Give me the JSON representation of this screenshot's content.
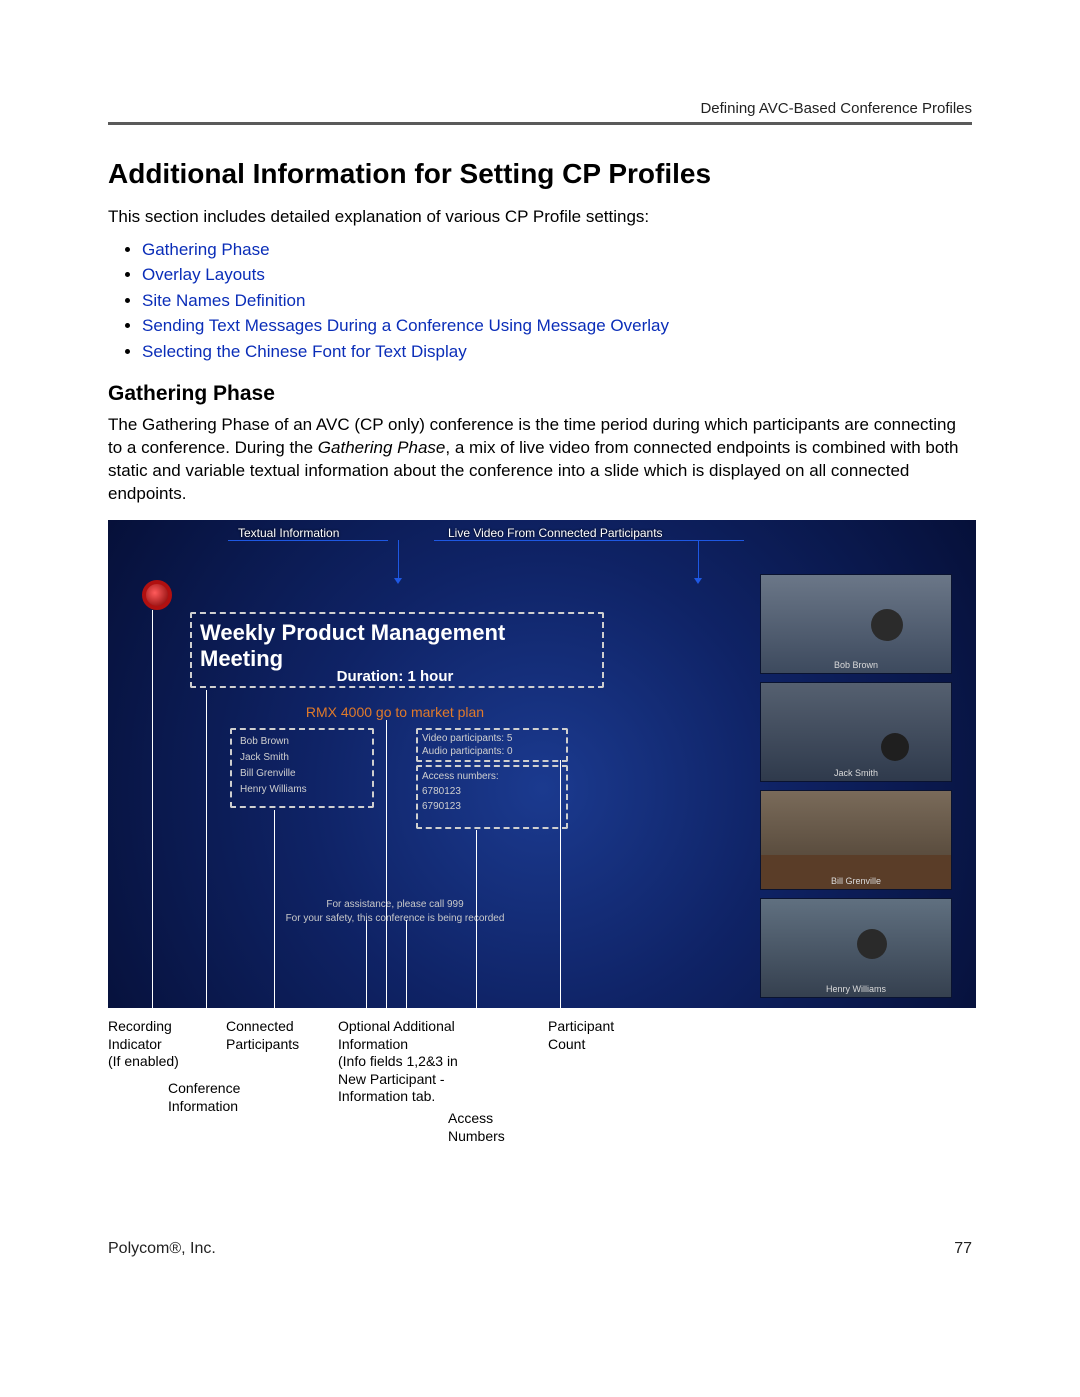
{
  "header": {
    "section": "Defining AVC-Based Conference Profiles"
  },
  "main": {
    "h1": "Additional Information for Setting CP Profiles",
    "intro": "This section includes detailed explanation of various CP Profile settings:",
    "links": [
      "Gathering Phase",
      "Overlay Layouts",
      "Site Names Definition",
      "Sending Text Messages During a Conference Using Message Overlay",
      "Selecting the Chinese Font for Text Display"
    ],
    "h2": "Gathering Phase",
    "para_a": "The Gathering Phase of an AVC (CP only) conference is the time period during which participants are connecting to a conference. During the ",
    "para_em": "Gathering Phase",
    "para_b": ", a mix of live video from connected endpoints is combined with both static and variable textual information about the conference into a slide which is displayed on all connected endpoints."
  },
  "figure": {
    "top_label_left": "Textual Information",
    "top_label_right": "Live Video From Connected Participants",
    "title": "Weekly Product Management Meeting",
    "duration": "Duration: 1 hour",
    "subtitle": "RMX 4000 go to market plan",
    "participants": [
      "Bob Brown",
      "Jack Smith",
      "Bill Grenville",
      "Henry Williams"
    ],
    "video_counts": "Video participants: 5",
    "audio_counts": "Audio participants: 0",
    "access_label": "Access numbers:",
    "access_numbers": [
      "6780123",
      "6790123"
    ],
    "assist1": "For assistance, please call 999",
    "assist2": "For your safety, this conference is being recorded",
    "captions": [
      "Bob Brown",
      "Jack Smith",
      "Bill Grenville",
      "Henry Williams"
    ],
    "callouts": {
      "recording": "Recording\nIndicator\n(If enabled)",
      "connected": "Connected\nParticipants",
      "optional": "Optional Additional\nInformation\n(Info fields 1,2&3 in\nNew Participant -\nInformation tab.",
      "pcount": "Participant\nCount",
      "conf_info": "Conference\nInformation",
      "access": "Access\nNumbers"
    }
  },
  "footer": {
    "company": "Polycom®, Inc.",
    "page": "77"
  }
}
